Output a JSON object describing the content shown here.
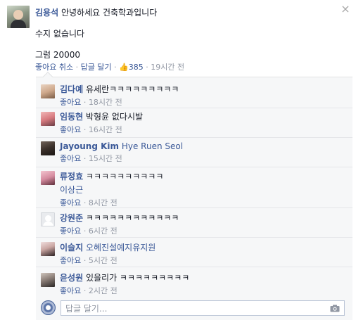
{
  "post": {
    "author": "김용석",
    "title_line": "안녕하세요 건축학과입니다",
    "line2": "수지 없습니다",
    "line3": "그럼 20000",
    "actions": {
      "unlike": "좋아요 취소",
      "reply": "답글 달기",
      "like_count": "385",
      "time": "19시간 전"
    },
    "close_icon": "close-icon"
  },
  "comments": [
    {
      "author": "김다예",
      "text": "유세란ㅋㅋㅋㅋㅋㅋㅋㅋㅋ",
      "text2": "",
      "like": "좋아요",
      "time": "18시간 전",
      "tag_text": false
    },
    {
      "author": "임동현",
      "text": "박형윤 없다시발",
      "text2": "",
      "like": "좋아요",
      "time": "16시간 전",
      "tag_text": false
    },
    {
      "author": "Jayoung Kim",
      "text": "Hye Ruen Seol",
      "text2": "",
      "like": "좋아요",
      "time": "15시간 전",
      "tag_text": true
    },
    {
      "author": "류정효",
      "text": "ㅋㅋㅋㅋㅋㅋㅋㅋㅋㅋ",
      "text2": "이상근",
      "like": "좋아요",
      "time": "8시간 전",
      "tag_text": false
    },
    {
      "author": "강원준",
      "text": "ㅋㅋㅋㅋㅋㅋㅋㅋㅋㅋㅋㅋ",
      "text2": "",
      "like": "좋아요",
      "time": "6시간 전",
      "tag_text": false
    },
    {
      "author": "이슬지",
      "text": "오혜진설예지유지원",
      "text2": "",
      "like": "좋아요",
      "time": "5시간 전",
      "tag_text": true
    },
    {
      "author": "윤성원",
      "text": "있을리가 ㅋㅋㅋㅋㅋㅋㅋㅋㅋ",
      "text2": "",
      "like": "좋아요",
      "time": "2시간 전",
      "tag_text": false
    }
  ],
  "reply": {
    "placeholder": "답글 달기..."
  },
  "colors": {
    "link": "#3b5998",
    "muted": "#9197a3",
    "panel": "#f6f7f8"
  }
}
